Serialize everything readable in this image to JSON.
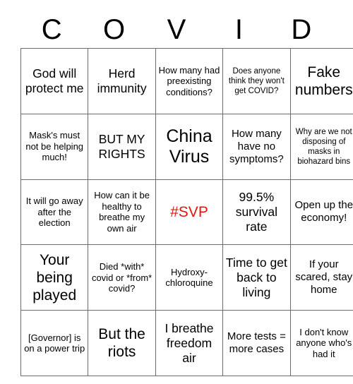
{
  "card": {
    "header_letters": [
      "C",
      "O",
      "V",
      "I",
      "D"
    ],
    "accent_color": "#e8140c",
    "border_color": "#6b6b6b",
    "rows": [
      [
        {
          "text": "God will protect me",
          "size": "lg",
          "color": "default"
        },
        {
          "text": "Herd immunity",
          "size": "lg",
          "color": "default"
        },
        {
          "text": "How many had preexisting conditions?",
          "size": "sm",
          "color": "default"
        },
        {
          "text": "Does anyone think they won't get COVID?",
          "size": "xs",
          "color": "default"
        },
        {
          "text": "Fake numbers",
          "size": "xl",
          "color": "default"
        }
      ],
      [
        {
          "text": "Mask's must not be helping much!",
          "size": "sm",
          "color": "default"
        },
        {
          "text": "BUT MY RIGHTS",
          "size": "lg",
          "color": "default"
        },
        {
          "text": "China Virus",
          "size": "xxl",
          "color": "default"
        },
        {
          "text": "How many have no symptoms?",
          "size": "md",
          "color": "default"
        },
        {
          "text": "Why are we not disposing of masks in biohazard bins",
          "size": "xs",
          "color": "default"
        }
      ],
      [
        {
          "text": "It will go away after the election",
          "size": "sm",
          "color": "default"
        },
        {
          "text": "How can it be healthy to breathe my own air",
          "size": "sm",
          "color": "default"
        },
        {
          "text": "#SVP",
          "size": "xl",
          "color": "accent"
        },
        {
          "text": "99.5% survival rate",
          "size": "lg",
          "color": "default"
        },
        {
          "text": "Open up the economy!",
          "size": "md",
          "color": "default"
        }
      ],
      [
        {
          "text": "Your being played",
          "size": "xl",
          "color": "default"
        },
        {
          "text": "Died *with* covid or *from* covid?",
          "size": "sm",
          "color": "default"
        },
        {
          "text": "Hydroxy-chloroquine",
          "size": "sm",
          "color": "default"
        },
        {
          "text": "Time to get back to living",
          "size": "lg",
          "color": "default"
        },
        {
          "text": "If your scared, stay home",
          "size": "md",
          "color": "default"
        }
      ],
      [
        {
          "text": "[Governor] is on a power trip",
          "size": "sm",
          "color": "default"
        },
        {
          "text": "But the riots",
          "size": "xl",
          "color": "default"
        },
        {
          "text": "I breathe freedom air",
          "size": "lg",
          "color": "default"
        },
        {
          "text": "More tests = more cases",
          "size": "md",
          "color": "default"
        },
        {
          "text": "I don't know anyone who's had it",
          "size": "sm",
          "color": "default"
        }
      ]
    ]
  }
}
